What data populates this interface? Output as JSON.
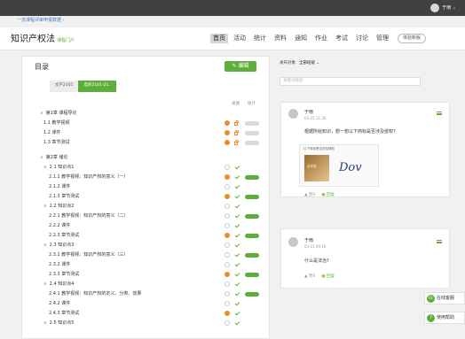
{
  "topbar": {
    "username": "于雨 ⌄"
  },
  "breadcrumb": "一流课程评审申报数据 ›",
  "course": {
    "title": "知识产权法",
    "subtitle": "课程门户"
  },
  "nav": {
    "items": [
      {
        "label": "首页",
        "active": true
      },
      {
        "label": "活动"
      },
      {
        "label": "统计"
      },
      {
        "label": "资料"
      },
      {
        "label": "通知"
      },
      {
        "label": "作业"
      },
      {
        "label": "考试"
      },
      {
        "label": "讨论"
      },
      {
        "label": "管理"
      }
    ],
    "experience": "体验新版"
  },
  "catalog": {
    "title": "目录",
    "edit_label": "编辑",
    "tabs": [
      {
        "label": "文产2101"
      },
      {
        "label": "电商2101-21..",
        "active": true
      }
    ],
    "col_publish": "发放",
    "col_stats": "统计",
    "rows": [
      {
        "text": "第1章 课程导论",
        "level": 0,
        "tg": "∧"
      },
      {
        "text": "1.1 教学视频",
        "level": 1,
        "st": "warn",
        "mk": "lock",
        "bar": "gr"
      },
      {
        "text": "1.2 课件",
        "level": 1,
        "st": "warn",
        "mk": "lock",
        "bar": "gr"
      },
      {
        "text": "1.3 章节测试",
        "level": 1,
        "st": "warn",
        "mk": "lock",
        "bar": "gr"
      },
      {
        "text": "第2章 绪论",
        "level": 0,
        "tg": "∧"
      },
      {
        "text": "2.1 知识点1",
        "level": 1,
        "tg": "∧",
        "st": "ring",
        "mk": "tick"
      },
      {
        "text": "2.1.1 教学视频：知识产权的意义（一）",
        "level": 2,
        "st": "warn",
        "mk": "tick",
        "bar": "g"
      },
      {
        "text": "2.1.2 课件",
        "level": 2,
        "st": "ring",
        "mk": "tick"
      },
      {
        "text": "2.1.3 章节测试",
        "level": 2,
        "st": "warn",
        "mk": "tick",
        "bar": "g"
      },
      {
        "text": "2.2 知识点2",
        "level": 1,
        "tg": "∧",
        "st": "ring",
        "mk": "tick"
      },
      {
        "text": "2.2.1 教学视频：知识产权的意义（二）",
        "level": 2,
        "st": "ring",
        "mk": "tick",
        "bar": "g"
      },
      {
        "text": "2.2.2 课件",
        "level": 2,
        "st": "ring",
        "mk": "tick"
      },
      {
        "text": "2.2.3 章节测试",
        "level": 2,
        "st": "warn",
        "mk": "tick",
        "bar": "g"
      },
      {
        "text": "2.3 知识点3",
        "level": 1,
        "tg": "∧",
        "st": "ring",
        "mk": "tick"
      },
      {
        "text": "2.3.1 教学视频：知识产权的意义（三）",
        "level": 2,
        "st": "ring",
        "mk": "tick",
        "bar": "g"
      },
      {
        "text": "2.3.2 课件",
        "level": 2,
        "st": "ring",
        "mk": "tick"
      },
      {
        "text": "2.3.3 章节测试",
        "level": 2,
        "st": "warn",
        "mk": "tick",
        "bar": "g"
      },
      {
        "text": "2.4 知识点4",
        "level": 1,
        "tg": "∧",
        "st": "ring",
        "mk": "tick"
      },
      {
        "text": "2.4.1 教学视频：知识产权的定义、分类、效果",
        "level": 2,
        "st": "ring",
        "mk": "tick",
        "bar": "g"
      },
      {
        "text": "2.4.2 课件",
        "level": 2,
        "st": "ring",
        "mk": "tick"
      },
      {
        "text": "2.4.3 章节测试",
        "level": 2,
        "st": "warn",
        "mk": "tick"
      },
      {
        "text": "2.5 知识点5",
        "level": 1,
        "tg": "∧",
        "st": "ring",
        "mk": "tick"
      }
    ]
  },
  "discussion": {
    "filter_label": "发布对象",
    "filter_value": "全部班级  ⌄",
    "search_placeholder": "关键词搜索",
    "posts": [
      {
        "name": "于雨",
        "date": "03-25 11:26",
        "text": "根据所给知识，想一想以下商标是否涉及侵权?",
        "like": "赞0",
        "reply": "回复",
        "attach_caption": "以下商标是否涉及侵权",
        "attach_product": "丝华芙",
        "attach_logo": "Dov"
      },
      {
        "name": "于雨",
        "date": "03-25 09:16",
        "text": "什么是法治?",
        "like": "赞0",
        "reply": "回复"
      }
    ]
  },
  "float": {
    "service": "在线客服",
    "help": "使用帮助"
  }
}
